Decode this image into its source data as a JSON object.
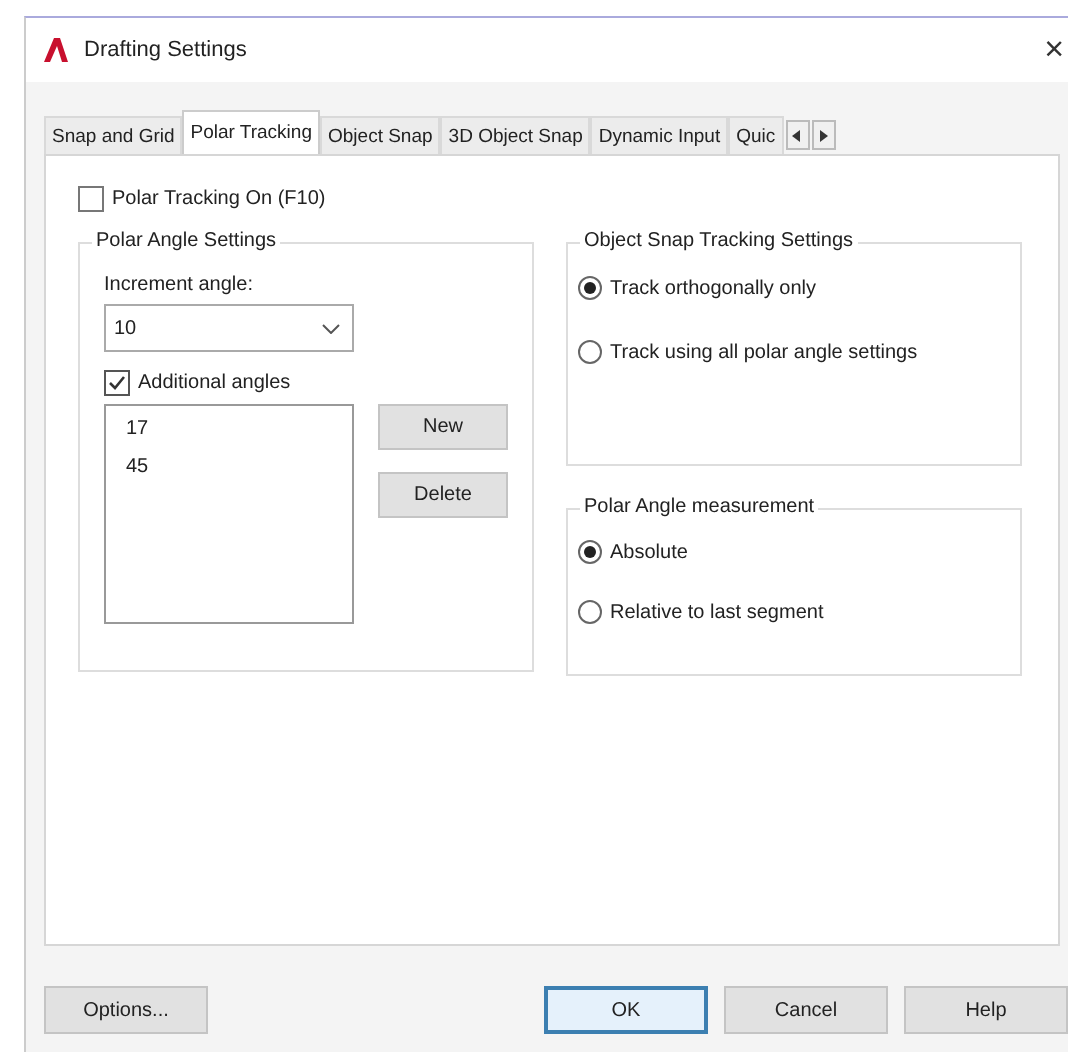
{
  "window": {
    "title": "Drafting Settings",
    "close": "×"
  },
  "tabs": [
    {
      "label": "Snap and Grid",
      "selected": false
    },
    {
      "label": "Polar Tracking",
      "selected": true
    },
    {
      "label": "Object Snap",
      "selected": false
    },
    {
      "label": "3D Object Snap",
      "selected": false
    },
    {
      "label": "Dynamic Input",
      "selected": false
    },
    {
      "label": "Quic",
      "selected": false
    }
  ],
  "polar_tracking_on": {
    "label": "Polar Tracking On (F10)",
    "checked": false
  },
  "polar_angle_settings": {
    "title": "Polar Angle Settings",
    "increment_label": "Increment angle:",
    "increment_value": "10",
    "additional": {
      "label": "Additional angles",
      "checked": true
    },
    "angles": [
      "17",
      "45"
    ],
    "buttons": [
      "New",
      "Delete"
    ]
  },
  "object_snap_tracking": {
    "title": "Object Snap Tracking Settings",
    "options": [
      {
        "label": "Track orthogonally only",
        "selected": true
      },
      {
        "label": "Track using all polar angle settings",
        "selected": false
      }
    ]
  },
  "polar_angle_measurement": {
    "title": "Polar Angle measurement",
    "options": [
      {
        "label": "Absolute",
        "selected": true
      },
      {
        "label": "Relative to last segment",
        "selected": false
      }
    ]
  },
  "footer_left": [
    {
      "label": "Options...",
      "default": false
    }
  ],
  "footer_right": [
    {
      "label": "OK",
      "default": true
    },
    {
      "label": "Cancel",
      "default": false
    },
    {
      "label": "Help",
      "default": false
    }
  ]
}
